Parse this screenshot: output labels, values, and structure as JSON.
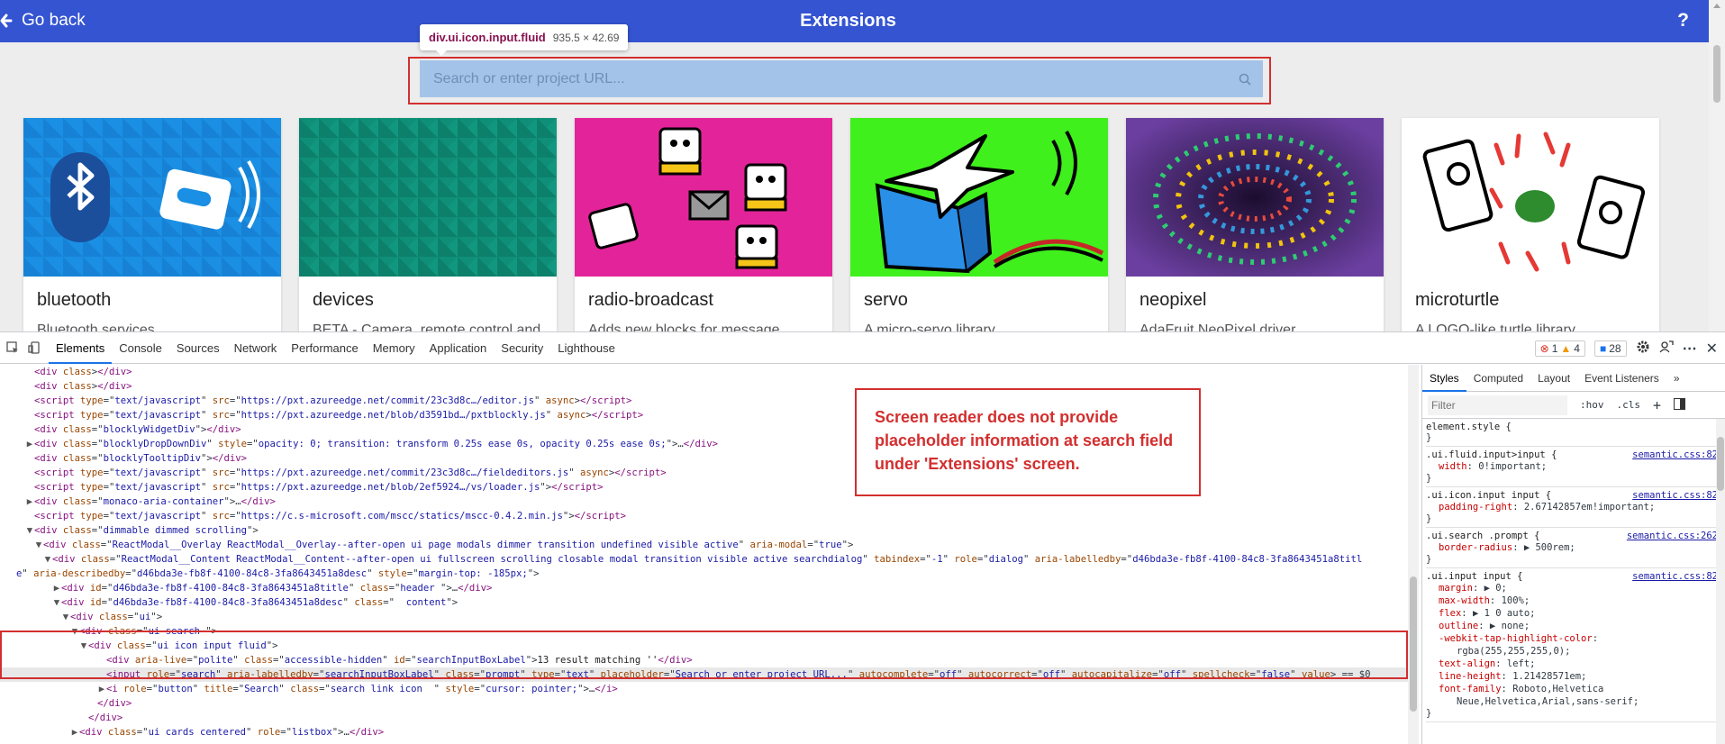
{
  "header": {
    "back_label": "Go back",
    "title": "Extensions",
    "help": "?"
  },
  "tooltip": {
    "tag": "div.ui.icon.input.fluid",
    "dims": "935.5 × 42.69"
  },
  "search": {
    "placeholder": "Search or enter project URL...",
    "value": ""
  },
  "cards": [
    {
      "title": "bluetooth",
      "desc": "Bluetooth services"
    },
    {
      "title": "devices",
      "desc": "BETA - Camera, remote control and"
    },
    {
      "title": "radio-broadcast",
      "desc": "Adds new blocks for message"
    },
    {
      "title": "servo",
      "desc": "A micro-servo library"
    },
    {
      "title": "neopixel",
      "desc": "AdaFruit NeoPixel driver"
    },
    {
      "title": "microturtle",
      "desc": "A LOGO-like turtle library"
    }
  ],
  "devtools": {
    "tabs": [
      "Elements",
      "Console",
      "Sources",
      "Network",
      "Performance",
      "Memory",
      "Application",
      "Security",
      "Lighthouse"
    ],
    "errors": "1",
    "warnings": "4",
    "messages": "28",
    "more": "»"
  },
  "code_lines": [
    {
      "tri": "",
      "indent": 2,
      "html": "<span class='t-tag'>&lt;div</span> <span class='t-attr'>class</span>&gt;<span class='t-tag'>&lt;/div&gt;</span>"
    },
    {
      "tri": "",
      "indent": 2,
      "html": "<span class='t-tag'>&lt;div</span> <span class='t-attr'>class</span>&gt;<span class='t-tag'>&lt;/div&gt;</span>"
    },
    {
      "tri": "",
      "indent": 2,
      "html": "<span class='t-tag'>&lt;script</span> <span class='t-attr'>type</span>=\"<span class='t-val'>text/javascript</span>\" <span class='t-attr'>src</span>=\"<span class='t-val'>https://pxt.azureedge.net/commit/23c3d8c…/editor.js</span>\" <span class='t-attr'>async</span>&gt;<span class='t-tag'>&lt;/script&gt;</span>"
    },
    {
      "tri": "",
      "indent": 2,
      "html": "<span class='t-tag'>&lt;script</span> <span class='t-attr'>type</span>=\"<span class='t-val'>text/javascript</span>\" <span class='t-attr'>src</span>=\"<span class='t-val'>https://pxt.azureedge.net/blob/d3591bd…/pxtblockly.js</span>\" <span class='t-attr'>async</span>&gt;<span class='t-tag'>&lt;/script&gt;</span>"
    },
    {
      "tri": "",
      "indent": 2,
      "html": "<span class='t-tag'>&lt;div</span> <span class='t-attr'>class</span>=\"<span class='t-val'>blocklyWidgetDiv</span>\"&gt;<span class='t-tag'>&lt;/div&gt;</span>"
    },
    {
      "tri": "▶",
      "indent": 2,
      "html": "<span class='t-tag'>&lt;div</span> <span class='t-attr'>class</span>=\"<span class='t-val'>blocklyDropDownDiv</span>\" <span class='t-attr'>style</span>=\"<span class='t-val'>opacity: 0; transition: transform 0.25s ease 0s, opacity 0.25s ease 0s;</span>\"&gt;…<span class='t-tag'>&lt;/div&gt;</span>"
    },
    {
      "tri": "",
      "indent": 2,
      "html": "<span class='t-tag'>&lt;div</span> <span class='t-attr'>class</span>=\"<span class='t-val'>blocklyTooltipDiv</span>\"&gt;<span class='t-tag'>&lt;/div&gt;</span>"
    },
    {
      "tri": "",
      "indent": 2,
      "html": "<span class='t-tag'>&lt;script</span> <span class='t-attr'>type</span>=\"<span class='t-val'>text/javascript</span>\" <span class='t-attr'>src</span>=\"<span class='t-val'>https://pxt.azureedge.net/commit/23c3d8c…/fieldeditors.js</span>\" <span class='t-attr'>async</span>&gt;<span class='t-tag'>&lt;/script&gt;</span>"
    },
    {
      "tri": "",
      "indent": 2,
      "html": "<span class='t-tag'>&lt;script</span> <span class='t-attr'>type</span>=\"<span class='t-val'>text/javascript</span>\" <span class='t-attr'>src</span>=\"<span class='t-val'>https://pxt.azureedge.net/blob/2ef5924…/vs/loader.js</span>\"&gt;<span class='t-tag'>&lt;/script&gt;</span>"
    },
    {
      "tri": "▶",
      "indent": 2,
      "html": "<span class='t-tag'>&lt;div</span> <span class='t-attr'>class</span>=\"<span class='t-val'>monaco-aria-container</span>\"&gt;…<span class='t-tag'>&lt;/div&gt;</span>"
    },
    {
      "tri": "",
      "indent": 2,
      "html": "<span class='t-tag'>&lt;script</span> <span class='t-attr'>type</span>=\"<span class='t-val'>text/javascript</span>\" <span class='t-attr'>src</span>=\"<span class='t-val'>https://c.s-microsoft.com/mscc/statics/mscc-0.4.2.min.js</span>\"&gt;<span class='t-tag'>&lt;/script&gt;</span>"
    },
    {
      "tri": "▼",
      "indent": 2,
      "html": "<span class='t-tag'>&lt;div</span> <span class='t-attr'>class</span>=\"<span class='t-val'>dimmable dimmed scrolling</span>\"&gt;"
    },
    {
      "tri": "▼",
      "indent": 3,
      "html": "<span class='t-tag'>&lt;div</span> <span class='t-attr'>class</span>=\"<span class='t-val'>ReactModal__Overlay ReactModal__Overlay--after-open ui page modals dimmer transition undefined visible active</span>\" <span class='t-attr'>aria-modal</span>=\"<span class='t-val'>true</span>\"&gt;"
    },
    {
      "tri": "▼",
      "indent": 4,
      "html": "<span class='t-tag'>&lt;div</span> <span class='t-attr'>class</span>=\"<span class='t-val'>ReactModal__Content ReactModal__Content--after-open ui fullscreen scrolling closable modal transition visible active searchdialog</span>\" <span class='t-attr'>tabindex</span>=\"<span class='t-val'>-1</span>\" <span class='t-attr'>role</span>=\"<span class='t-val'>dialog</span>\" <span class='t-attr'>aria-labelledby</span>=\"<span class='t-val'>d46bda3e-fb8f-4100-84c8-3fa8643451a8titl</span>"
    },
    {
      "tri": "",
      "indent": 0,
      "html": "<span class='t-val'>e</span>\" <span class='t-attr'>aria-describedby</span>=\"<span class='t-val'>d46bda3e-fb8f-4100-84c8-3fa8643451a8desc</span>\" <span class='t-attr'>style</span>=\"<span class='t-val'>margin-top: -185px;</span>\"&gt;"
    },
    {
      "tri": "▶",
      "indent": 5,
      "html": "<span class='t-tag'>&lt;div</span> <span class='t-attr'>id</span>=\"<span class='t-val'>d46bda3e-fb8f-4100-84c8-3fa8643451a8title</span>\" <span class='t-attr'>class</span>=\"<span class='t-val'>header </span>\"&gt;…<span class='t-tag'>&lt;/div&gt;</span>"
    },
    {
      "tri": "▼",
      "indent": 5,
      "html": "<span class='t-tag'>&lt;div</span> <span class='t-attr'>id</span>=\"<span class='t-val'>d46bda3e-fb8f-4100-84c8-3fa8643451a8desc</span>\" <span class='t-attr'>class</span>=\"<span class='t-val'>  content</span>\"&gt;"
    },
    {
      "tri": "▼",
      "indent": 6,
      "html": "<span class='t-tag'>&lt;div</span> <span class='t-attr'>class</span>=\"<span class='t-val'>ui</span>\"&gt;"
    },
    {
      "tri": "▼",
      "indent": 7,
      "html": "<span class='t-tag'>&lt;div</span> <span class='t-attr'>class</span>=\"<span class='t-val'>ui search </span>\"&gt;"
    },
    {
      "tri": "▼",
      "indent": 8,
      "html": "<span class='t-tag'>&lt;div</span> <span class='t-attr'>class</span>=\"<span class='t-val'>ui icon input fluid</span>\"&gt;"
    },
    {
      "tri": "",
      "indent": 10,
      "html": "<span class='t-tag'>&lt;div</span> <span class='t-attr'>aria-live</span>=\"<span class='t-val'>polite</span>\" <span class='t-attr'>class</span>=\"<span class='t-val'>accessible-hidden</span>\" <span class='t-attr'>id</span>=\"<span class='t-val'>searchInputBoxLabel</span>\"&gt;<span class='t-text'>13 result matching ''</span><span class='t-tag'>&lt;/div&gt;</span>"
    },
    {
      "tri": "",
      "indent": 10,
      "sel": true,
      "html": "<span class='t-tag'>&lt;input</span> <span class='t-attr'>role</span>=\"<span class='t-val'>search</span>\" <span class='t-attr'>aria-labelledby</span>=\"<span class='t-val'>searchInputBoxLabel</span>\" <span class='t-attr'>class</span>=\"<span class='t-val'>prompt</span>\" <span class='t-attr'>type</span>=\"<span class='t-val'>text</span>\" <span class='t-attr'>placeholder</span>=\"<span class='t-val'>Search or enter project URL...</span>\" <span class='t-attr'>autocomplete</span>=\"<span class='t-val'>off</span>\" <span class='t-attr'>autocorrect</span>=\"<span class='t-val'>off</span>\" <span class='t-attr'>autocapitalize</span>=\"<span class='t-val'>off</span>\" <span class='t-attr'>spellcheck</span>=\"<span class='t-val'>false</span>\" <span class='t-attr'>value</span>&gt; == $0"
    },
    {
      "tri": "▶",
      "indent": 10,
      "html": "<span class='t-tag'>&lt;i</span> <span class='t-attr'>role</span>=\"<span class='t-val'>button</span>\" <span class='t-attr'>title</span>=\"<span class='t-val'>Search</span>\" <span class='t-attr'>class</span>=\"<span class='t-val'>search link icon  </span>\" <span class='t-attr'>style</span>=\"<span class='t-val'>cursor: pointer;</span>\"&gt;…<span class='t-tag'>&lt;/i&gt;</span>"
    },
    {
      "tri": "",
      "indent": 9,
      "html": "<span class='t-tag'>&lt;/div&gt;</span>"
    },
    {
      "tri": "",
      "indent": 8,
      "html": "<span class='t-tag'>&lt;/div&gt;</span>"
    },
    {
      "tri": "▶",
      "indent": 7,
      "html": "<span class='t-tag'>&lt;div</span> <span class='t-attr'>class</span>=\"<span class='t-val'>ui cards centered</span>\" <span class='t-attr'>role</span>=\"<span class='t-val'>listbox</span>\"&gt;…<span class='t-tag'>&lt;/div&gt;</span>"
    }
  ],
  "annotation": "Screen reader does not provide placeholder information at search field under 'Extensions' screen.",
  "styles": {
    "tabs": [
      "Styles",
      "Computed",
      "Layout",
      "Event Listeners"
    ],
    "more": "»",
    "filter_placeholder": "Filter",
    "hov": ":hov",
    "cls": ".cls",
    "plus": "+",
    "rules": [
      {
        "selector": "element.style {",
        "source": "",
        "decls": []
      },
      {
        "selector": ".ui.fluid.input>input {",
        "source": "semantic.css:82",
        "decls": [
          [
            "width",
            "0!important;"
          ]
        ]
      },
      {
        "selector": ".ui.icon.input input {",
        "source": "semantic.css:82",
        "decls": [
          [
            "padding-right",
            "2.67142857em!important;"
          ]
        ]
      },
      {
        "selector": ".ui.search .prompt {",
        "source": "semantic.css:262",
        "decls": [
          [
            "border-radius",
            "▶ 500rem;"
          ]
        ]
      },
      {
        "selector": ".ui.input input {",
        "source": "semantic.css:82",
        "decls": [
          [
            "margin",
            "▶ 0;"
          ],
          [
            "max-width",
            "100%;"
          ],
          [
            "flex",
            "▶ 1 0 auto;"
          ],
          [
            "outline",
            "▶ none;"
          ],
          [
            "-webkit-tap-highlight-color",
            ""
          ],
          [
            "",
            "rgba(255,255,255,0);"
          ],
          [
            "text-align",
            "left;"
          ],
          [
            "line-height",
            "1.21428571em;"
          ],
          [
            "font-family",
            "Roboto,Helvetica"
          ],
          [
            "",
            "Neue,Helvetica,Arial,sans-serif;"
          ]
        ]
      }
    ]
  },
  "colors": {
    "header_bg": "#3454d1",
    "highlight_red": "#d32f2f",
    "search_bg": "#a4c3e9"
  }
}
